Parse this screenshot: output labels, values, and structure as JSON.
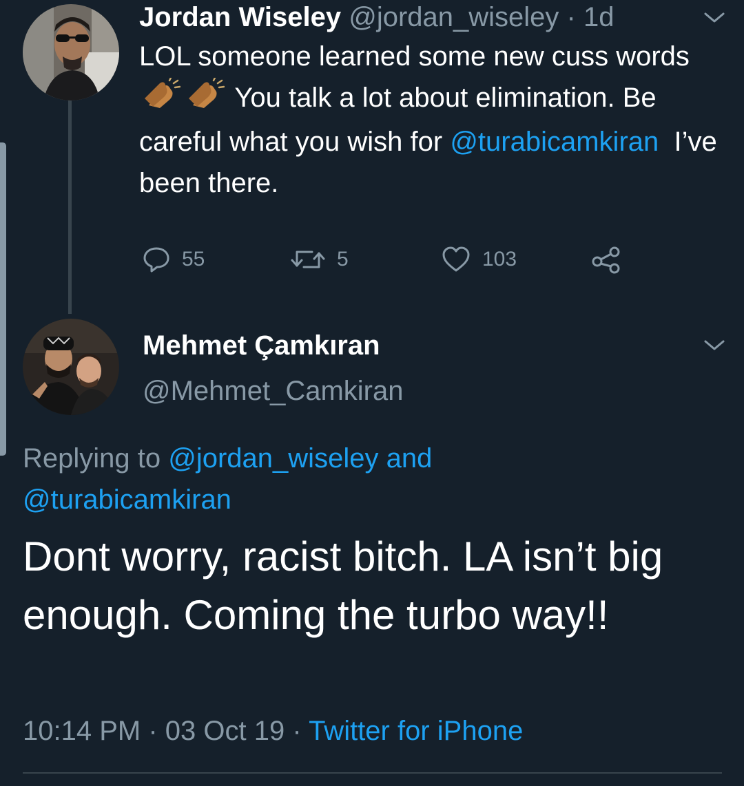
{
  "tweet1": {
    "author_name": "Jordan Wiseley",
    "author_handle": "@jordan_wiseley",
    "separator": "·",
    "time_ago": "1d",
    "text_part1": "LOL someone learned some new cuss words",
    "emoji": [
      "clapping-hands-emoji",
      "clapping-hands-emoji"
    ],
    "text_part2": "You talk a lot about elimination. Be careful what you wish for",
    "mention": "@turabicamkiran",
    "text_part3": "I’ve been there.",
    "actions": {
      "replies": "55",
      "retweets": "5",
      "likes": "103"
    },
    "menu_icon": "chevron-down-icon"
  },
  "tweet2": {
    "author_name": "Mehmet Çamkıran",
    "author_handle": "@Mehmet_Camkiran",
    "replying_prefix": "Replying to",
    "replying_mention1": "@jordan_wiseley",
    "replying_and": "and",
    "replying_mention2": "@turabicamkiran",
    "text": "Dont worry, racist bitch. LA isn’t big enough. Coming the turbo way!!",
    "time": "10:14 PM",
    "separator": "·",
    "date": "03 Oct 19",
    "separator2": "·",
    "source": "Twitter for iPhone",
    "menu_icon": "chevron-down-icon"
  },
  "colors": {
    "background": "#15202b",
    "text_primary": "#ffffff",
    "text_secondary": "#8899a6",
    "link": "#1da1f2",
    "divider": "#38444d"
  }
}
